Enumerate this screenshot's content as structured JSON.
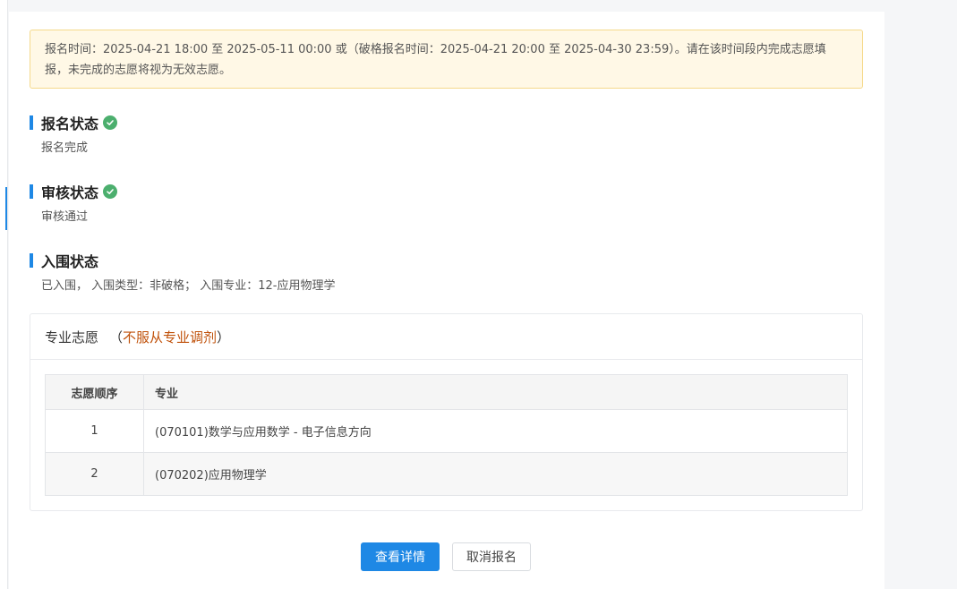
{
  "notice": {
    "text": "报名时间：2025-04-21 18:00 至 2025-05-11 00:00 或（破格报名时间：2025-04-21 20:00 至 2025-04-30 23:59）。请在该时间段内完成志愿填报，未完成的志愿将视为无效志愿。"
  },
  "registration": {
    "title": "报名状态",
    "status": "报名完成"
  },
  "review": {
    "title": "审核状态",
    "status": "审核通过"
  },
  "shortlist": {
    "title": "入围状态",
    "status": "已入围， 入围类型：非破格； 入围专业：12-应用物理学"
  },
  "preference": {
    "title": "专业志愿",
    "paren_open": "（",
    "adjust_note": "不服从专业调剂",
    "paren_close": "）",
    "columns": [
      "志愿顺序",
      "专业"
    ],
    "rows": [
      {
        "order": "1",
        "major": "(070101)数学与应用数学 - 电子信息方向"
      },
      {
        "order": "2",
        "major": "(070202)应用物理学"
      }
    ]
  },
  "actions": {
    "view_details": "查看详情",
    "cancel_registration": "取消报名"
  },
  "colors": {
    "accent": "#1e88e5",
    "success": "#4caf6e",
    "warning_text": "#c0510a",
    "notice_bg": "#fff8e6"
  },
  "icons": {
    "status_ok": "check-circle-icon"
  }
}
